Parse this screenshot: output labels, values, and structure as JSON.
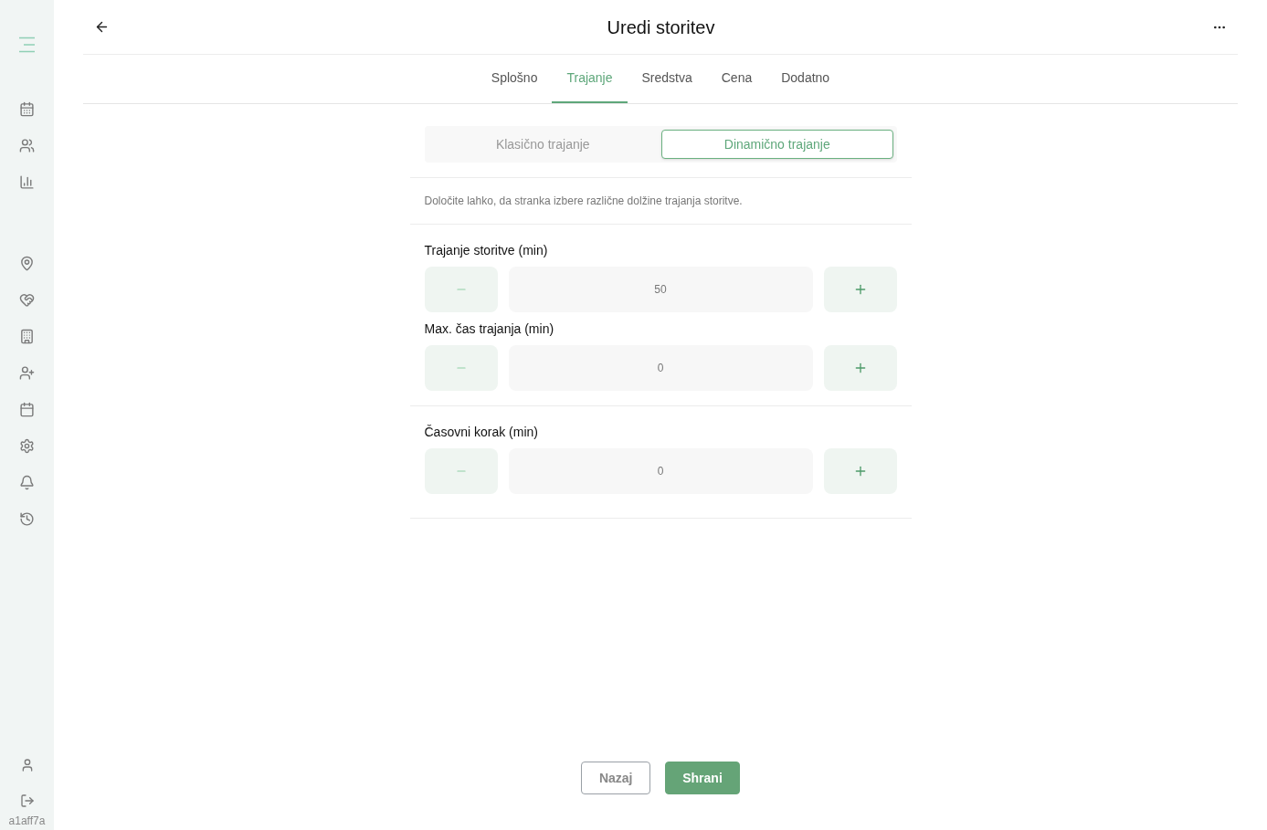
{
  "header": {
    "title": "Uredi storitev"
  },
  "tabs": [
    {
      "label": "Splošno",
      "selected": false
    },
    {
      "label": "Trajanje",
      "selected": true
    },
    {
      "label": "Sredstva",
      "selected": false
    },
    {
      "label": "Cena",
      "selected": false
    },
    {
      "label": "Dodatno",
      "selected": false
    }
  ],
  "mode_toggle": [
    {
      "label": "Klasično trajanje",
      "selected": false
    },
    {
      "label": "Dinamično trajanje",
      "selected": true
    }
  ],
  "description": "Določite lahko, da stranka izbere različne dolžine trajanja storitve.",
  "sections": [
    {
      "fields": [
        {
          "label": "Trajanje storitve (min)",
          "value": "50"
        },
        {
          "label": "Max. čas trajanja (min)",
          "value": "0"
        }
      ]
    },
    {
      "fields": [
        {
          "label": "Časovni korak (min)",
          "value": "0"
        }
      ]
    }
  ],
  "buttons": [
    {
      "kind": "secondary",
      "label": "Nazaj"
    },
    {
      "kind": "primary",
      "label": "Shrani"
    }
  ],
  "sidebar": {
    "version": "a1aff7a"
  }
}
